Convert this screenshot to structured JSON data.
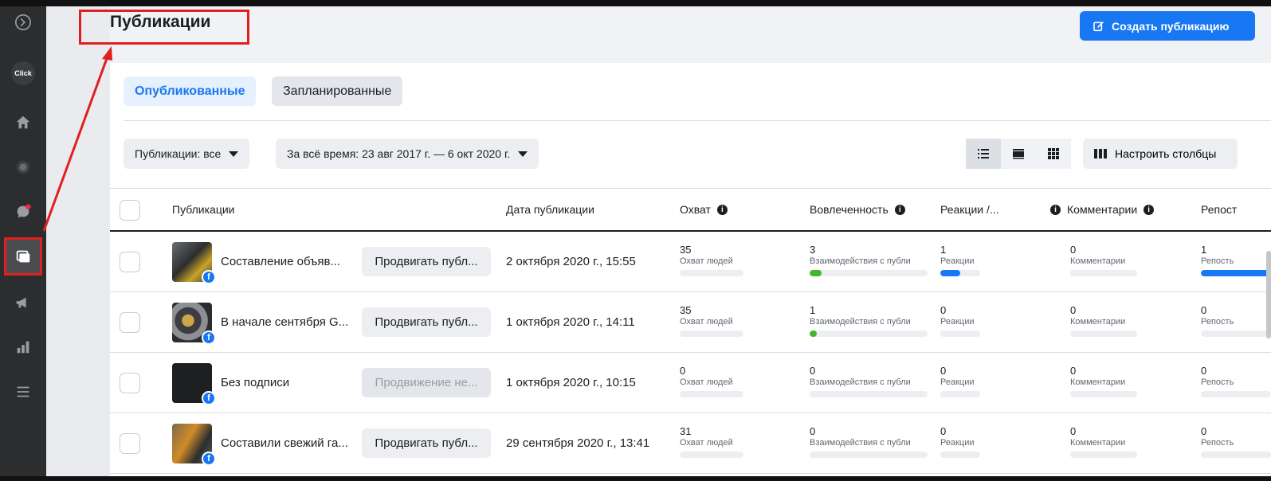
{
  "header": {
    "title": "Публикации",
    "create_label": "Создать публикацию"
  },
  "sidebar": {
    "items": [
      {
        "icon": "logo-icon"
      },
      {
        "icon": "click-avatar",
        "label": "Click"
      },
      {
        "icon": "home-icon"
      },
      {
        "icon": "messenger-icon"
      },
      {
        "icon": "chat-icon"
      },
      {
        "icon": "publications-icon",
        "active": true
      },
      {
        "icon": "megaphone-icon"
      },
      {
        "icon": "insights-icon"
      },
      {
        "icon": "menu-icon"
      }
    ]
  },
  "tabs": [
    {
      "label": "Опубликованные",
      "active": true
    },
    {
      "label": "Запланированные",
      "active": false
    }
  ],
  "filters": {
    "posts": "Публикации: все",
    "range": "За всё время: 23 авг 2017 г. — 6 окт 2020 г."
  },
  "toolbar": {
    "columns_label": "Настроить столбцы"
  },
  "table": {
    "headers": {
      "post": "Публикации",
      "date": "Дата публикации",
      "reach": "Охват",
      "engagement": "Вовлеченность",
      "reactions": "Реакции /...",
      "comments": "Комментарии",
      "shares": "Репост"
    },
    "rows": [
      {
        "text": "Составление объяв...",
        "promote": "Продвигать публ...",
        "promote_disabled": false,
        "date": "2 октября 2020 г., 15:55",
        "reach": "35",
        "reach_label": "Охват людей",
        "engagement": "3",
        "engagement_label": "Взаимодействия с публи",
        "engagement_fill": 0.1,
        "reactions": "1",
        "reactions_label": "Реакции",
        "reactions_fill": 0.5,
        "comments": "0",
        "comments_label": "Комментарии",
        "shares": "1",
        "shares_label": "Репость",
        "shares_fill": 1.0
      },
      {
        "text": "В начале сентября G...",
        "promote": "Продвигать публ...",
        "promote_disabled": false,
        "date": "1 октября 2020 г., 14:11",
        "reach": "35",
        "reach_label": "Охват людей",
        "engagement": "1",
        "engagement_label": "Взаимодействия с публи",
        "engagement_fill": 0.03,
        "reactions": "0",
        "reactions_label": "Реакции",
        "reactions_fill": 0,
        "comments": "0",
        "comments_label": "Комментарии",
        "shares": "0",
        "shares_label": "Репость",
        "shares_fill": 0
      },
      {
        "text": "Без подписи",
        "promote": "Продвижение не...",
        "promote_disabled": true,
        "date": "1 октября 2020 г., 10:15",
        "reach": "0",
        "reach_label": "Охват людей",
        "engagement": "0",
        "engagement_label": "Взаимодействия с публи",
        "engagement_fill": 0,
        "reactions": "0",
        "reactions_label": "Реакции",
        "reactions_fill": 0,
        "comments": "0",
        "comments_label": "Комментарии",
        "shares": "0",
        "shares_label": "Репость",
        "shares_fill": 0
      },
      {
        "text": "Составили свежий га...",
        "promote": "Продвигать публ...",
        "promote_disabled": false,
        "date": "29 сентября 2020 г., 13:41",
        "reach": "31",
        "reach_label": "Охват людей",
        "engagement": "0",
        "engagement_label": "Взаимодействия с публи",
        "engagement_fill": 0,
        "reactions": "0",
        "reactions_label": "Реакции",
        "reactions_fill": 0,
        "comments": "0",
        "comments_label": "Комментарии",
        "shares": "0",
        "shares_label": "Репость",
        "shares_fill": 0
      }
    ]
  },
  "colors": {
    "accent": "#1877f2",
    "engagement_bar": "#42b72a",
    "annotation": "#e02020"
  }
}
